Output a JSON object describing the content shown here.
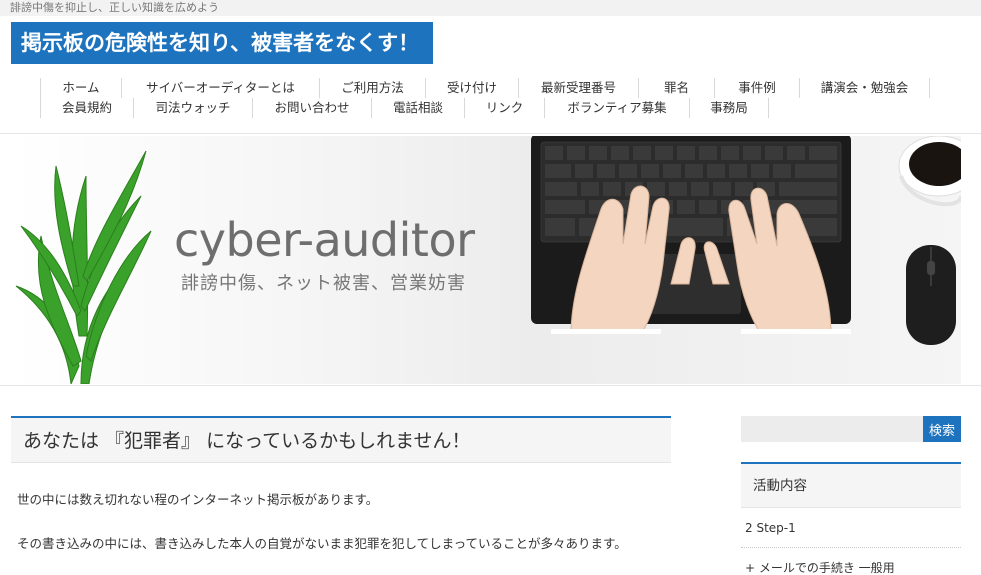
{
  "header": {
    "tagline": "誹謗中傷を抑止し、正しい知識を広めよう",
    "site_title": "掲示板の危険性を知り、被害者をなくす！"
  },
  "nav": {
    "row1": [
      "ホーム",
      "サイバーオーディターとは",
      "ご利用方法",
      "受け付け",
      "最新受理番号",
      "罪名",
      "事件例",
      "講演会・勉強会"
    ],
    "row2": [
      "会員規約",
      "司法ウォッチ",
      "お問い合わせ",
      "電話相談",
      "リンク",
      "ボランティア募集",
      "事務局"
    ]
  },
  "hero": {
    "title": "cyber-auditor",
    "subtitle": "誹謗中傷、ネット被害、営業妨害"
  },
  "article": {
    "title": "あなたは 『犯罪者』 になっているかもしれません！",
    "paragraphs": [
      "世の中には数え切れない程のインターネット掲示板があります。",
      "その書き込みの中には、書き込みした本人の自覚がないまま犯罪を犯してしまっていることが多々あります。"
    ]
  },
  "sidebar": {
    "search": {
      "placeholder": "",
      "button_label": "検索"
    },
    "widget": {
      "title": "活動内容",
      "items": [
        "2 Step-1"
      ],
      "subitems": [
        "+ メールでの手続き 一般用"
      ]
    }
  },
  "colors": {
    "accent": "#1e73be",
    "text": "#333333",
    "muted": "#777777"
  }
}
